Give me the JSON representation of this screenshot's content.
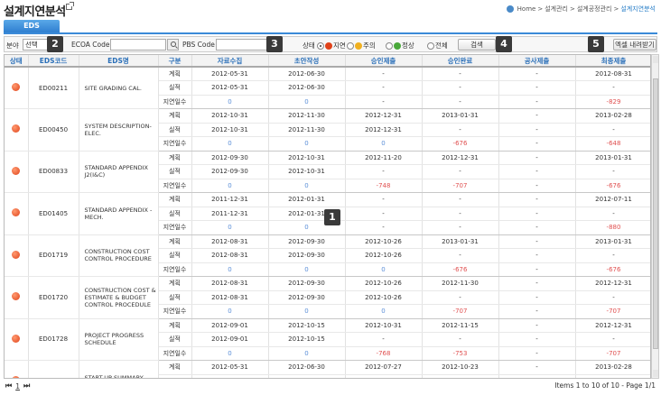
{
  "page": {
    "title": "설계지연분석",
    "breadcrumb": {
      "home": "Home",
      "sep": ">",
      "level1": "설계관리",
      "level2": "설계공정관리",
      "current": "설계지연분석"
    }
  },
  "tab": {
    "label": "EDS"
  },
  "filter": {
    "field_label": "분야",
    "field_value": "선택",
    "ecoa_label": "ECOA Code",
    "ecoa_value": "",
    "pbs_label": "PBS Code",
    "pbs_value": "",
    "status_label": "상태",
    "status_options": [
      {
        "label": "지연",
        "color": "#e0421a",
        "checked": true
      },
      {
        "label": "주의",
        "color": "#f0b020",
        "checked": false
      },
      {
        "label": "정상",
        "color": "#49a83a",
        "checked": false
      },
      {
        "label": "전체",
        "color": "",
        "checked": false
      }
    ],
    "search_button": "검색",
    "excel_button": "엑셀 내려받기"
  },
  "badges": [
    "1",
    "2",
    "3",
    "4",
    "5"
  ],
  "table": {
    "headers": [
      "상태",
      "EDS코드",
      "EDS명",
      "구분",
      "자료수집",
      "초안작성",
      "승인제출",
      "승인완료",
      "공사제출",
      "최종제출"
    ],
    "rows": [
      {
        "code": "ED00211",
        "name": "SITE GRADING CAL.",
        "status_color": "#e0421a",
        "lines": [
          [
            "계획",
            "2012-05-31",
            "2012-06-30",
            "-",
            "-",
            "-",
            "2012-08-31"
          ],
          [
            "실적",
            "2012-05-31",
            "2012-06-30",
            "-",
            "-",
            "-",
            "-"
          ],
          [
            "지연일수",
            "0",
            "0",
            "-",
            "-",
            "-",
            "-829"
          ]
        ]
      },
      {
        "code": "ED00450",
        "name": "SYSTEM DESCRIPTION-ELEC.",
        "status_color": "#e0421a",
        "lines": [
          [
            "계획",
            "2012-10-31",
            "2012-11-30",
            "2012-12-31",
            "2013-01-31",
            "-",
            "2013-02-28"
          ],
          [
            "실적",
            "2012-10-31",
            "2012-11-30",
            "2012-12-31",
            "-",
            "-",
            "-"
          ],
          [
            "지연일수",
            "0",
            "0",
            "0",
            "-676",
            "-",
            "-648"
          ]
        ]
      },
      {
        "code": "ED00833",
        "name": "STANDARD APPENDIX J2(I&C)",
        "status_color": "#e0421a",
        "lines": [
          [
            "계획",
            "2012-09-30",
            "2012-10-31",
            "2012-11-20",
            "2012-12-31",
            "-",
            "2013-01-31"
          ],
          [
            "실적",
            "2012-09-30",
            "2012-10-31",
            "-",
            "-",
            "-",
            "-"
          ],
          [
            "지연일수",
            "0",
            "0",
            "-748",
            "-707",
            "-",
            "-676"
          ]
        ]
      },
      {
        "code": "ED01405",
        "name": "STANDARD APPENDIX - MECH.",
        "status_color": "#e0421a",
        "lines": [
          [
            "계획",
            "2011-12-31",
            "2012-01-31",
            "-",
            "-",
            "-",
            "2012-07-11"
          ],
          [
            "실적",
            "2011-12-31",
            "2012-01-31",
            "-",
            "-",
            "-",
            "-"
          ],
          [
            "지연일수",
            "0",
            "0",
            "-",
            "-",
            "-",
            "-880"
          ]
        ]
      },
      {
        "code": "ED01719",
        "name": "CONSTRUCTION COST CONTROL PROCEDURE",
        "status_color": "#e0421a",
        "lines": [
          [
            "계획",
            "2012-08-31",
            "2012-09-30",
            "2012-10-26",
            "2013-01-31",
            "-",
            "2013-01-31"
          ],
          [
            "실적",
            "2012-08-31",
            "2012-09-30",
            "2012-10-26",
            "-",
            "-",
            "-"
          ],
          [
            "지연일수",
            "0",
            "0",
            "0",
            "-676",
            "-",
            "-676"
          ]
        ]
      },
      {
        "code": "ED01720",
        "name": "CONSTRUCTION COST & ESTIMATE & BUDGET CONTROL PROCEDULE",
        "status_color": "#e0421a",
        "lines": [
          [
            "계획",
            "2012-08-31",
            "2012-09-30",
            "2012-10-26",
            "2012-11-30",
            "-",
            "2012-12-31"
          ],
          [
            "실적",
            "2012-08-31",
            "2012-09-30",
            "2012-10-26",
            "-",
            "-",
            "-"
          ],
          [
            "지연일수",
            "0",
            "0",
            "0",
            "-707",
            "-",
            "-707"
          ]
        ]
      },
      {
        "code": "ED01728",
        "name": "PROJECT PROGRESS SCHEDULE",
        "status_color": "#e0421a",
        "lines": [
          [
            "계획",
            "2012-09-01",
            "2012-10-15",
            "2012-10-31",
            "2012-11-15",
            "-",
            "2012-12-31"
          ],
          [
            "실적",
            "2012-09-01",
            "2012-10-15",
            "-",
            "-",
            "-",
            "-"
          ],
          [
            "지연일수",
            "0",
            "0",
            "-768",
            "-753",
            "-",
            "-707"
          ]
        ]
      },
      {
        "code": "ED01730",
        "name": "START-UP SUMMARY SCHEDULE",
        "status_color": "#e0421a",
        "lines": [
          [
            "계획",
            "2012-05-31",
            "2012-06-30",
            "2012-07-27",
            "2012-10-23",
            "-",
            "2013-02-28"
          ],
          [
            "실적",
            "2012-05-31",
            "2012-06-30",
            "2012-07-27",
            "-",
            "-",
            "-"
          ],
          [
            "지연일수",
            "0",
            "0",
            "0",
            "-",
            "-",
            "-"
          ]
        ]
      }
    ]
  },
  "pager": {
    "first": "⏮",
    "prev": "◀",
    "page": "1",
    "next": "▶",
    "last": "⏭",
    "info": "Items 1 to 10 of 10 - Page 1/1"
  }
}
